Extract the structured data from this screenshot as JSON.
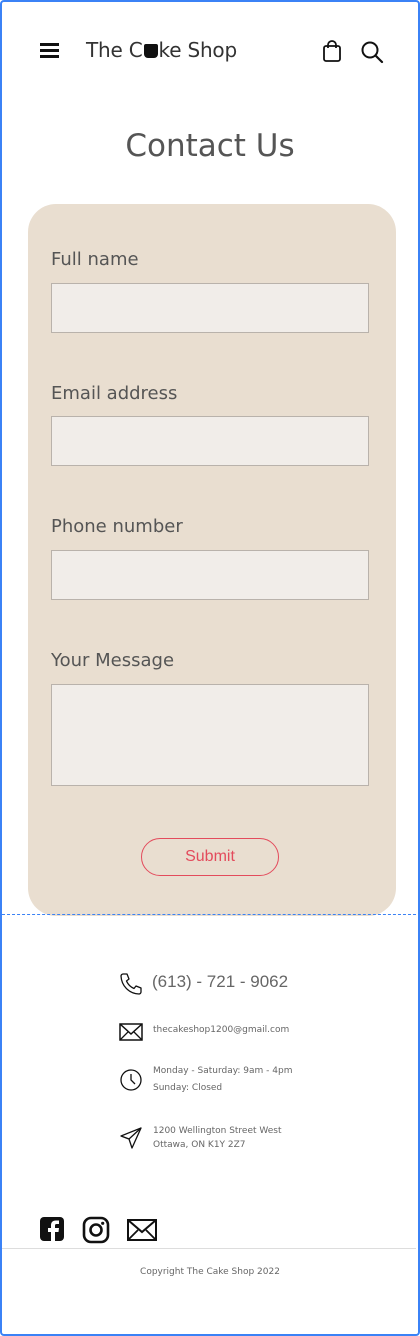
{
  "header": {
    "logo_prefix": "The C",
    "logo_suffix": "ke Shop",
    "icons": [
      "hamburger-menu-icon",
      "shopping-bag-icon",
      "search-icon"
    ]
  },
  "page": {
    "title": "Contact Us"
  },
  "form": {
    "fields": [
      {
        "label": "Full name",
        "value": ""
      },
      {
        "label": "Email address",
        "value": ""
      },
      {
        "label": "Phone number",
        "value": ""
      },
      {
        "label": "Your Message",
        "value": ""
      }
    ],
    "submit_label": "Submit"
  },
  "contact": {
    "phone": "(613) - 721 - 9062",
    "email": "thecakeshop1200@gmail.com",
    "hours_line1": "Monday - Saturday: 9am - 4pm",
    "hours_line2": "Sunday: Closed",
    "address_line1": "1200 Wellington Street West",
    "address_line2": "Ottawa, ON K1Y 2Z7"
  },
  "footer": {
    "social_icons": [
      "facebook-icon",
      "instagram-icon",
      "mail-icon"
    ],
    "copyright": "Copyright The Cake Shop 2022"
  },
  "colors": {
    "card_bg": "#e9ded0",
    "field_bg": "#f1ede9",
    "accent": "#e34b5c",
    "frame": "#3b82f6"
  }
}
